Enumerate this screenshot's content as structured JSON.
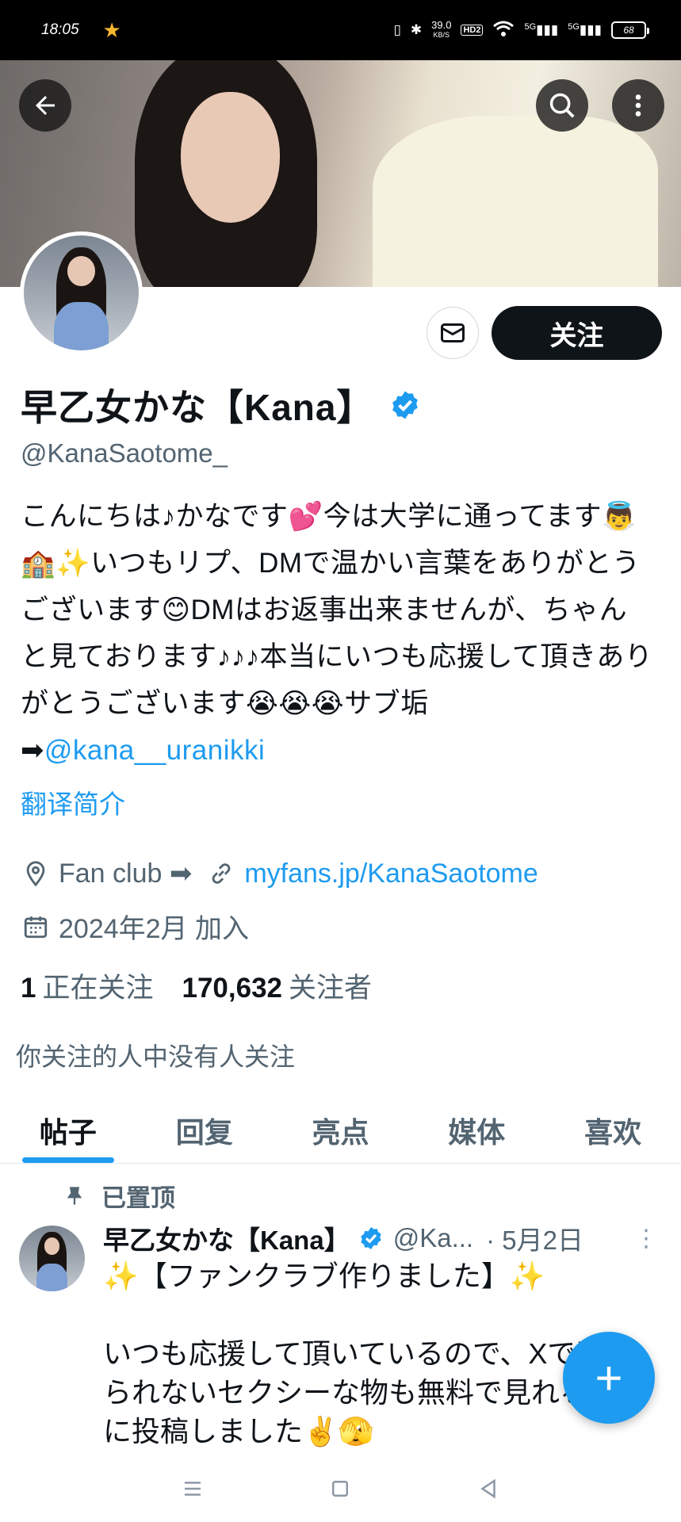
{
  "status_bar": {
    "time": "18:05",
    "speed_value": "39.0",
    "speed_unit": "KB/S",
    "hd_label": "HD2",
    "signal_1": "5G",
    "signal_2": "5G",
    "battery": "68"
  },
  "header": {
    "back_icon": "arrow-left-icon",
    "search_icon": "search-icon",
    "more_icon": "more-vertical-icon"
  },
  "profile": {
    "name": "早乙女かな【Kana】",
    "handle": "@KanaSaotome_",
    "follow_label": "关注",
    "bio_text": "こんにちは♪かなです💕今は大学に通ってます👼 🏫✨いつもリプ、DMで温かい言葉をありがとうございます😊DMはお返事出来ませんが、ちゃんと見ております♪♪♪本当にいつも応援して頂きありがとうございます😭😭😭サブ垢➡",
    "bio_mention": "@kana__uranikki",
    "translate_label": "翻译简介",
    "location": "Fan club ➡",
    "website": "myfans.jp/KanaSaotome",
    "joined": "2024年2月 加入",
    "following_count": "1",
    "following_label": "正在关注",
    "followers_count": "170,632",
    "followers_label": "关注者",
    "no_mutual": "你关注的人中没有人关注",
    "accent_color": "#1d9bf0"
  },
  "tabs": [
    {
      "label": "帖子"
    },
    {
      "label": "回复"
    },
    {
      "label": "亮点"
    },
    {
      "label": "媒体"
    },
    {
      "label": "喜欢"
    }
  ],
  "pinned_tweet": {
    "pinned_label": "已置顶",
    "author": "早乙女かな【Kana】",
    "handle": "@Ka...",
    "date": "· 5月2日",
    "text": "✨【ファンクラブ作りました】✨\n\nいつも応援して頂いているので、Xで載せられないセクシーな物も無料で見れるように投稿しました✌️🫣"
  },
  "fab": {
    "label": "+"
  }
}
